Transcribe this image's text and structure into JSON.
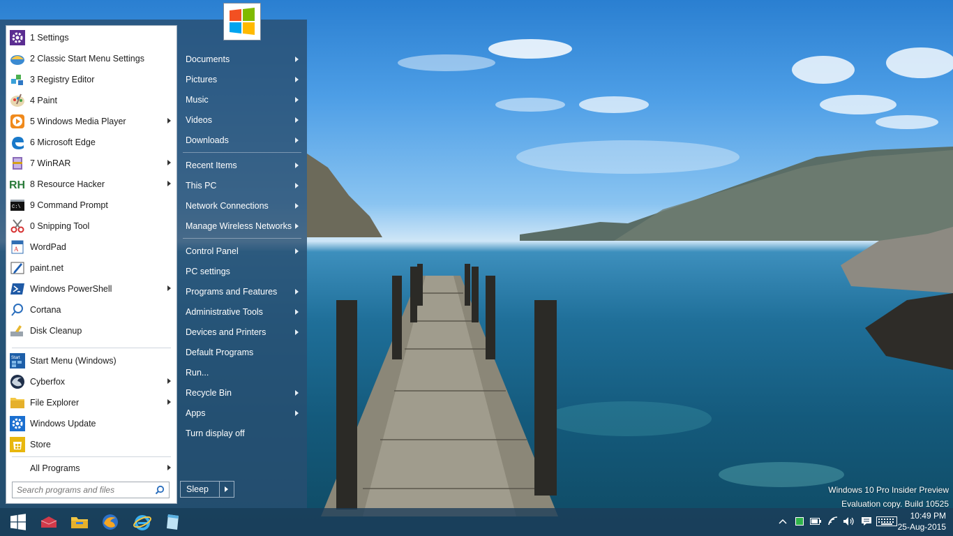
{
  "programs": [
    {
      "label": "1 Settings",
      "icon": "gear-icon",
      "has_submenu": false
    },
    {
      "label": "2 Classic Start Menu Settings",
      "icon": "shell-icon",
      "has_submenu": false
    },
    {
      "label": "3 Registry Editor",
      "icon": "registry-icon",
      "has_submenu": false
    },
    {
      "label": "4 Paint",
      "icon": "paint-palette-icon",
      "has_submenu": false
    },
    {
      "label": "5 Windows Media Player",
      "icon": "media-player-icon",
      "has_submenu": true
    },
    {
      "label": "6 Microsoft Edge",
      "icon": "edge-icon",
      "has_submenu": false
    },
    {
      "label": "7 WinRAR",
      "icon": "winrar-icon",
      "has_submenu": true
    },
    {
      "label": "8 Resource Hacker",
      "icon": "resource-hacker-icon",
      "has_submenu": true
    },
    {
      "label": "9 Command Prompt",
      "icon": "command-prompt-icon",
      "has_submenu": false
    },
    {
      "label": "0 Snipping Tool",
      "icon": "scissors-icon",
      "has_submenu": false
    },
    {
      "label": "WordPad",
      "icon": "wordpad-icon",
      "has_submenu": false
    },
    {
      "label": "paint.net",
      "icon": "paintnet-icon",
      "has_submenu": false
    },
    {
      "label": "Windows PowerShell",
      "icon": "powershell-icon",
      "has_submenu": true
    },
    {
      "label": "Cortana",
      "icon": "search-icon",
      "has_submenu": false
    },
    {
      "label": "Disk Cleanup",
      "icon": "disk-cleanup-icon",
      "has_submenu": false
    }
  ],
  "pinned": [
    {
      "label": "Start Menu (Windows)",
      "icon": "start-menu-icon",
      "has_submenu": false
    },
    {
      "label": "Cyberfox",
      "icon": "cyberfox-icon",
      "has_submenu": true
    },
    {
      "label": "File Explorer",
      "icon": "folder-icon",
      "has_submenu": true
    },
    {
      "label": "Windows Update",
      "icon": "update-gear-icon",
      "has_submenu": false
    },
    {
      "label": "Store",
      "icon": "store-icon",
      "has_submenu": false
    }
  ],
  "all_programs": "All Programs",
  "search_placeholder": "Search programs and files",
  "places": [
    {
      "label": "Documents",
      "has_submenu": true,
      "sep_after": false
    },
    {
      "label": "Pictures",
      "has_submenu": true,
      "sep_after": false
    },
    {
      "label": "Music",
      "has_submenu": true,
      "sep_after": false
    },
    {
      "label": "Videos",
      "has_submenu": true,
      "sep_after": false
    },
    {
      "label": "Downloads",
      "has_submenu": true,
      "sep_after": true
    },
    {
      "label": "Recent Items",
      "has_submenu": true,
      "sep_after": false
    },
    {
      "label": "This PC",
      "has_submenu": true,
      "sep_after": false
    },
    {
      "label": "Network Connections",
      "has_submenu": true,
      "sep_after": false
    },
    {
      "label": "Manage Wireless Networks",
      "has_submenu": true,
      "sep_after": true
    },
    {
      "label": "Control Panel",
      "has_submenu": true,
      "sep_after": false
    },
    {
      "label": "PC settings",
      "has_submenu": false,
      "sep_after": false
    },
    {
      "label": "Programs and Features",
      "has_submenu": true,
      "sep_after": false
    },
    {
      "label": "Administrative Tools",
      "has_submenu": true,
      "sep_after": false
    },
    {
      "label": "Devices and Printers",
      "has_submenu": true,
      "sep_after": false
    },
    {
      "label": "Default Programs",
      "has_submenu": false,
      "sep_after": false
    },
    {
      "label": "Run...",
      "has_submenu": false,
      "sep_after": false
    },
    {
      "label": "Recycle Bin",
      "has_submenu": true,
      "sep_after": false
    },
    {
      "label": "Apps",
      "has_submenu": true,
      "sep_after": false
    },
    {
      "label": "Turn display off",
      "has_submenu": false,
      "sep_after": false
    }
  ],
  "sleep_label": "Sleep",
  "taskbar": {
    "icons": [
      "windows-start-icon",
      "toolbox-icon",
      "file-explorer-icon",
      "cyberfox-icon",
      "internet-explorer-icon",
      "notepad-icon"
    ]
  },
  "tray": {
    "icons": [
      "chevron-up-icon",
      "green-square-icon",
      "battery-icon",
      "wifi-icon",
      "volume-icon",
      "notification-icon",
      "keyboard-icon"
    ],
    "time": "10:49 PM",
    "date": "25-Aug-2015"
  },
  "watermark": {
    "line1": "Windows 10 Pro Insider Preview",
    "line2": "Evaluation copy. Build 10525"
  },
  "colors": {
    "menu_panel": "#284e70",
    "taskbar": "#1c3c58",
    "accent": "#0078d7"
  }
}
